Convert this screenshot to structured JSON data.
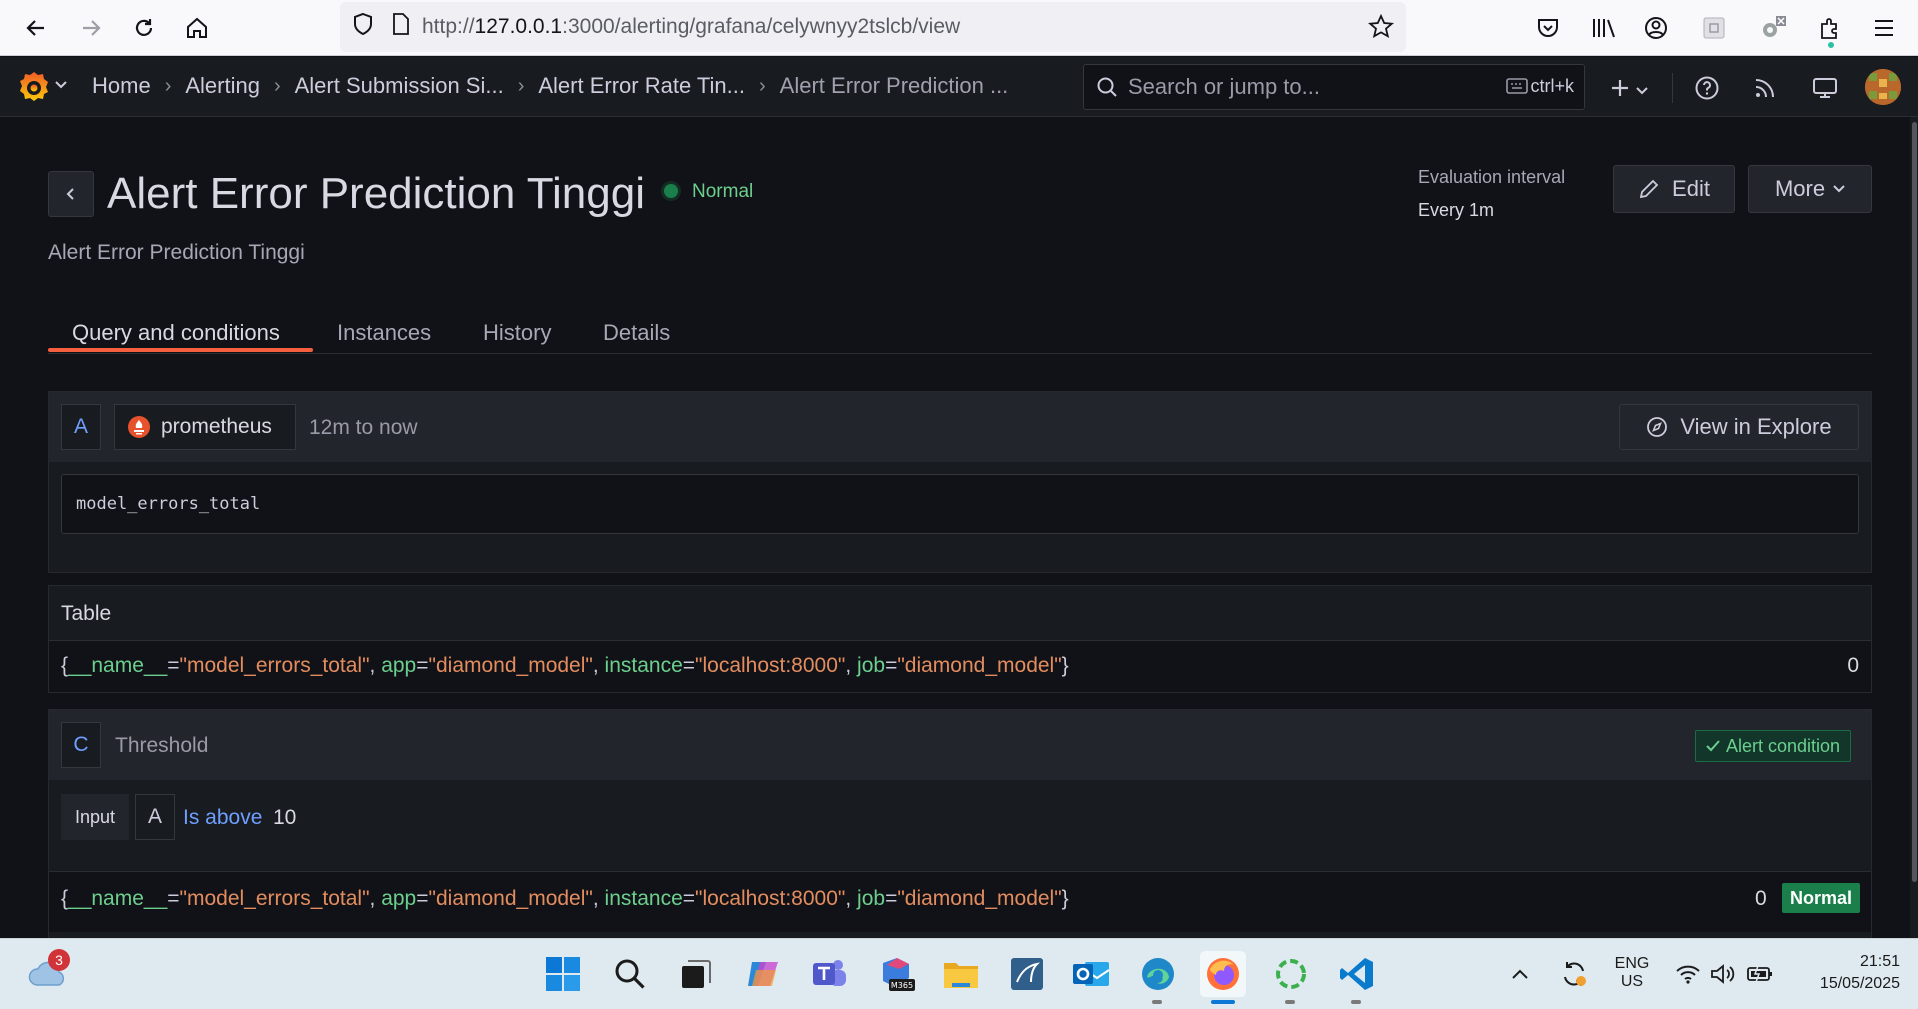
{
  "browser": {
    "url_prefix": "http://",
    "url_host": "127.0.0.1",
    "url_rest": ":3000/alerting/grafana/celywnyy2tslcb/view"
  },
  "topnav": {
    "breadcrumbs": [
      "Home",
      "Alerting",
      "Alert Submission Si...",
      "Alert Error Rate Tin...",
      "Alert Error Prediction ..."
    ],
    "search_placeholder": "Search or jump to...",
    "search_shortcut": "ctrl+k"
  },
  "header": {
    "title": "Alert Error Prediction Tinggi",
    "state": "Normal",
    "subtitle": "Alert Error Prediction Tinggi",
    "eval_label": "Evaluation interval",
    "eval_value": "Every 1m",
    "edit_label": "Edit",
    "more_label": "More"
  },
  "tabs": [
    "Query and conditions",
    "Instances",
    "History",
    "Details"
  ],
  "query": {
    "ref": "A",
    "datasource": "prometheus",
    "time_range": "12m to now",
    "explore_label": "View in Explore",
    "expr": "model_errors_total"
  },
  "table": {
    "title": "Table",
    "series": {
      "open": "{",
      "labels": [
        {
          "k": "__name__",
          "v": "\"model_errors_total\""
        },
        {
          "k": "app",
          "v": "\"diamond_model\""
        },
        {
          "k": "instance",
          "v": "\"localhost:8000\""
        },
        {
          "k": "job",
          "v": "\"diamond_model\""
        }
      ],
      "close": "}"
    },
    "value": "0"
  },
  "condition": {
    "ref": "C",
    "name": "Threshold",
    "badge": "Alert condition",
    "input_label": "Input",
    "input_ref": "A",
    "operator": "Is above",
    "threshold": "10",
    "result_value": "0",
    "result_state": "Normal"
  },
  "taskbar": {
    "weather_badge": "3",
    "lang1": "ENG",
    "lang2": "US",
    "time": "21:51",
    "date": "15/05/2025"
  },
  "colors": {
    "accent_tab": "#f55f3e",
    "normal_green": "#1a7f4b",
    "state_text": "#6ccf8e",
    "link_blue": "#6e9fff"
  }
}
